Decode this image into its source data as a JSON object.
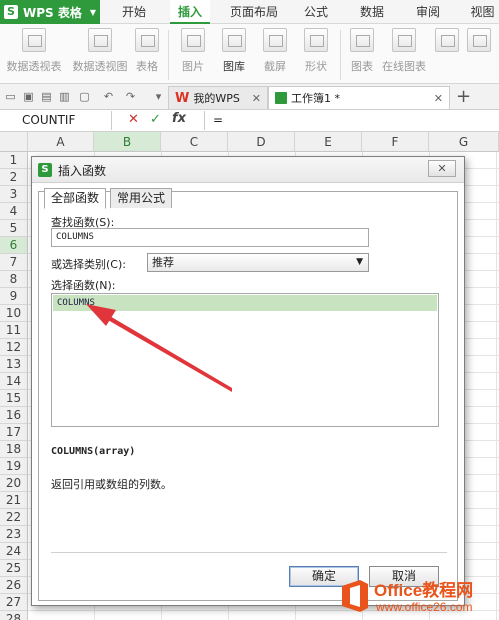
{
  "app": {
    "logo": "S",
    "title": "WPS 表格"
  },
  "menu": {
    "tabs": [
      "开始",
      "插入",
      "页面布局",
      "公式",
      "数据",
      "审阅",
      "视图"
    ],
    "active": "插入"
  },
  "ribbon": {
    "buttons": [
      "数据透视表",
      "数据透视图",
      "表格",
      "图片",
      "图库",
      "截屏",
      "形状",
      "图表",
      "在线图表"
    ]
  },
  "doc_tabs": [
    {
      "label": "我的WPS",
      "active": false
    },
    {
      "label": "工作簿1 *",
      "active": true
    }
  ],
  "formula_bar": {
    "name_box": "COUNTIF",
    "fx": "fx",
    "content": "="
  },
  "grid": {
    "columns": [
      "A",
      "B",
      "C",
      "D",
      "E",
      "F",
      "G"
    ],
    "selected_column": "B",
    "rows": [
      "1",
      "2",
      "3",
      "4",
      "5",
      "6",
      "7",
      "8",
      "9",
      "10",
      "11",
      "12",
      "13",
      "14",
      "15",
      "16",
      "17",
      "18",
      "19",
      "20",
      "21",
      "22",
      "23",
      "24",
      "25",
      "26",
      "27",
      "28"
    ],
    "selected_row": "6"
  },
  "dialog": {
    "title": "插入函数",
    "close": "✕",
    "tabs": [
      "全部函数",
      "常用公式"
    ],
    "search_label": "查找函数(S):",
    "search_value": "COLUMNS",
    "category_label": "或选择类别(C):",
    "category_value": "推荐",
    "list_label": "选择函数(N):",
    "list_items": [
      "COLUMNS"
    ],
    "signature": "COLUMNS(array)",
    "description": "返回引用或数组的列数。",
    "ok": "确定",
    "cancel": "取消"
  },
  "watermark": {
    "line1": "Office教程网",
    "line2": "www.office26.com"
  },
  "colors": {
    "accent": "#2e9a3c",
    "selection": "#c8e3c0",
    "arrow": "#e0353a",
    "watermark": "#e8541c"
  }
}
